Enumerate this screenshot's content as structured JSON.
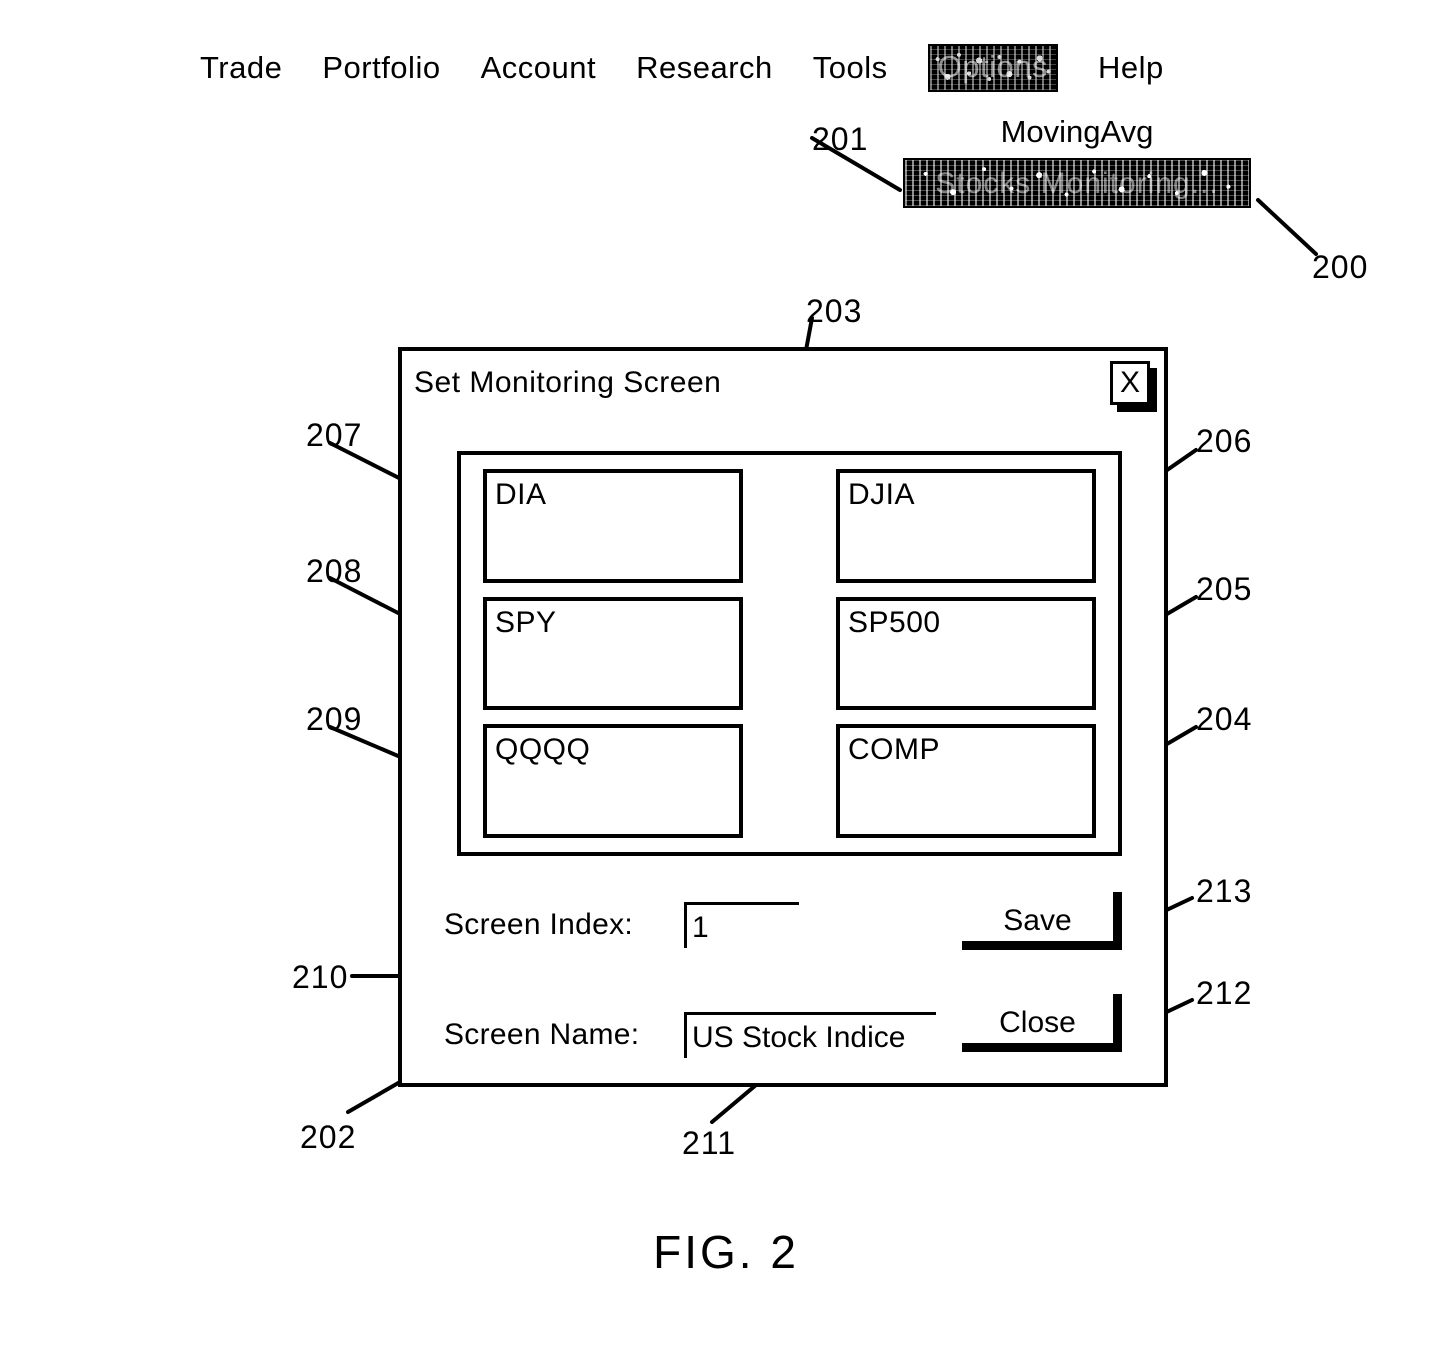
{
  "figure": {
    "caption": "FIG. 2"
  },
  "menubar": {
    "items": [
      {
        "label": "Trade",
        "selected": false
      },
      {
        "label": "Portfolio",
        "selected": false
      },
      {
        "label": "Account",
        "selected": false
      },
      {
        "label": "Research",
        "selected": false
      },
      {
        "label": "Tools",
        "selected": false
      },
      {
        "label": "Options",
        "selected": true
      },
      {
        "label": "Help",
        "selected": false
      }
    ]
  },
  "dropdown": {
    "items": [
      {
        "label": "MovingAvg",
        "highlighted": false
      },
      {
        "label": "Stocks Monitoring...",
        "highlighted": true
      }
    ]
  },
  "dialog": {
    "title": "Set Monitoring Screen",
    "close_icon": "X",
    "symbols": [
      {
        "ticker": "DIA",
        "index": "DJIA"
      },
      {
        "ticker": "SPY",
        "index": "SP500"
      },
      {
        "ticker": "QQQQ",
        "index": "COMP"
      }
    ],
    "form": {
      "screen_index_label": "Screen Index:",
      "screen_index_value": "1",
      "screen_name_label": "Screen Name:",
      "screen_name_value": "US Stock Indice"
    },
    "buttons": {
      "save": "Save",
      "close": "Close"
    }
  },
  "reference_numerals": {
    "n200": "200",
    "n201": "201",
    "n202": "202",
    "n203": "203",
    "n204": "204",
    "n205": "205",
    "n206": "206",
    "n207": "207",
    "n208": "208",
    "n209": "209",
    "n210": "210",
    "n211": "211",
    "n212": "212",
    "n213": "213"
  },
  "colors": {
    "ink": "#000000",
    "paper": "#ffffff"
  }
}
